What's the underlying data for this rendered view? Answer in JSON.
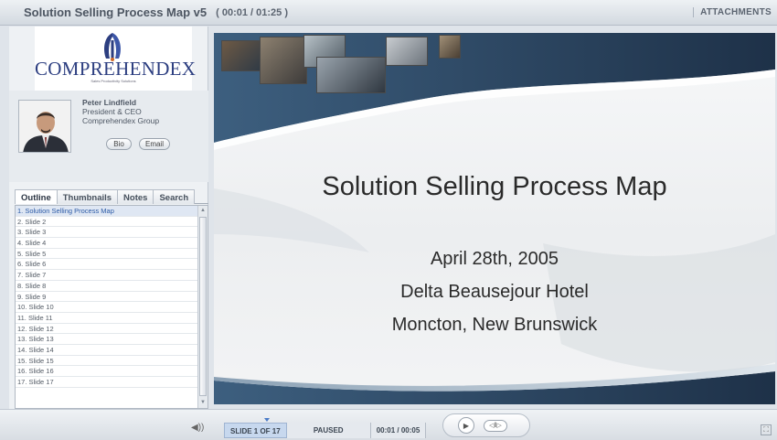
{
  "window": {
    "title": "Solution Selling Process Map v5",
    "timecode": "( 00:01 / 01:25 )",
    "attachments_label": "ATTACHMENTS"
  },
  "logo": {
    "text": "COMPREHENDEX",
    "subtext": "Sales Productivity Solutions"
  },
  "presenter": {
    "name": "Peter Lindfield",
    "title": "President & CEO",
    "organization": "Comprehendex Group",
    "bio_label": "Bio",
    "email_label": "Email"
  },
  "tabs": [
    {
      "label": "Outline",
      "active": true
    },
    {
      "label": "Thumbnails",
      "active": false
    },
    {
      "label": "Notes",
      "active": false
    },
    {
      "label": "Search",
      "active": false
    }
  ],
  "outline_items": [
    "1. Solution Selling Process Map",
    "2. Slide 2",
    "3. Slide 3",
    "4. Slide 4",
    "5. Slide 5",
    "6. Slide 6",
    "7. Slide 7",
    "8. Slide 8",
    "9. Slide 9",
    "10. Slide 10",
    "11. Slide 11",
    "12. Slide 12",
    "13. Slide 13",
    "14. Slide 14",
    "15. Slide 15",
    "16. Slide 16",
    "17. Slide 17"
  ],
  "slide": {
    "title": "Solution Selling Process Map",
    "lines": [
      "April 28th, 2005",
      "Delta Beausejour Hotel",
      "Moncton, New Brunswick"
    ]
  },
  "controls": {
    "slide_counter": "SLIDE 1 OF 17",
    "state": "PAUSED",
    "time": "00:01 / 00:05"
  },
  "colors": {
    "accent": "#4b7cc8",
    "logo_blue": "#2c3e80",
    "active_item": "#2c5aa6"
  }
}
